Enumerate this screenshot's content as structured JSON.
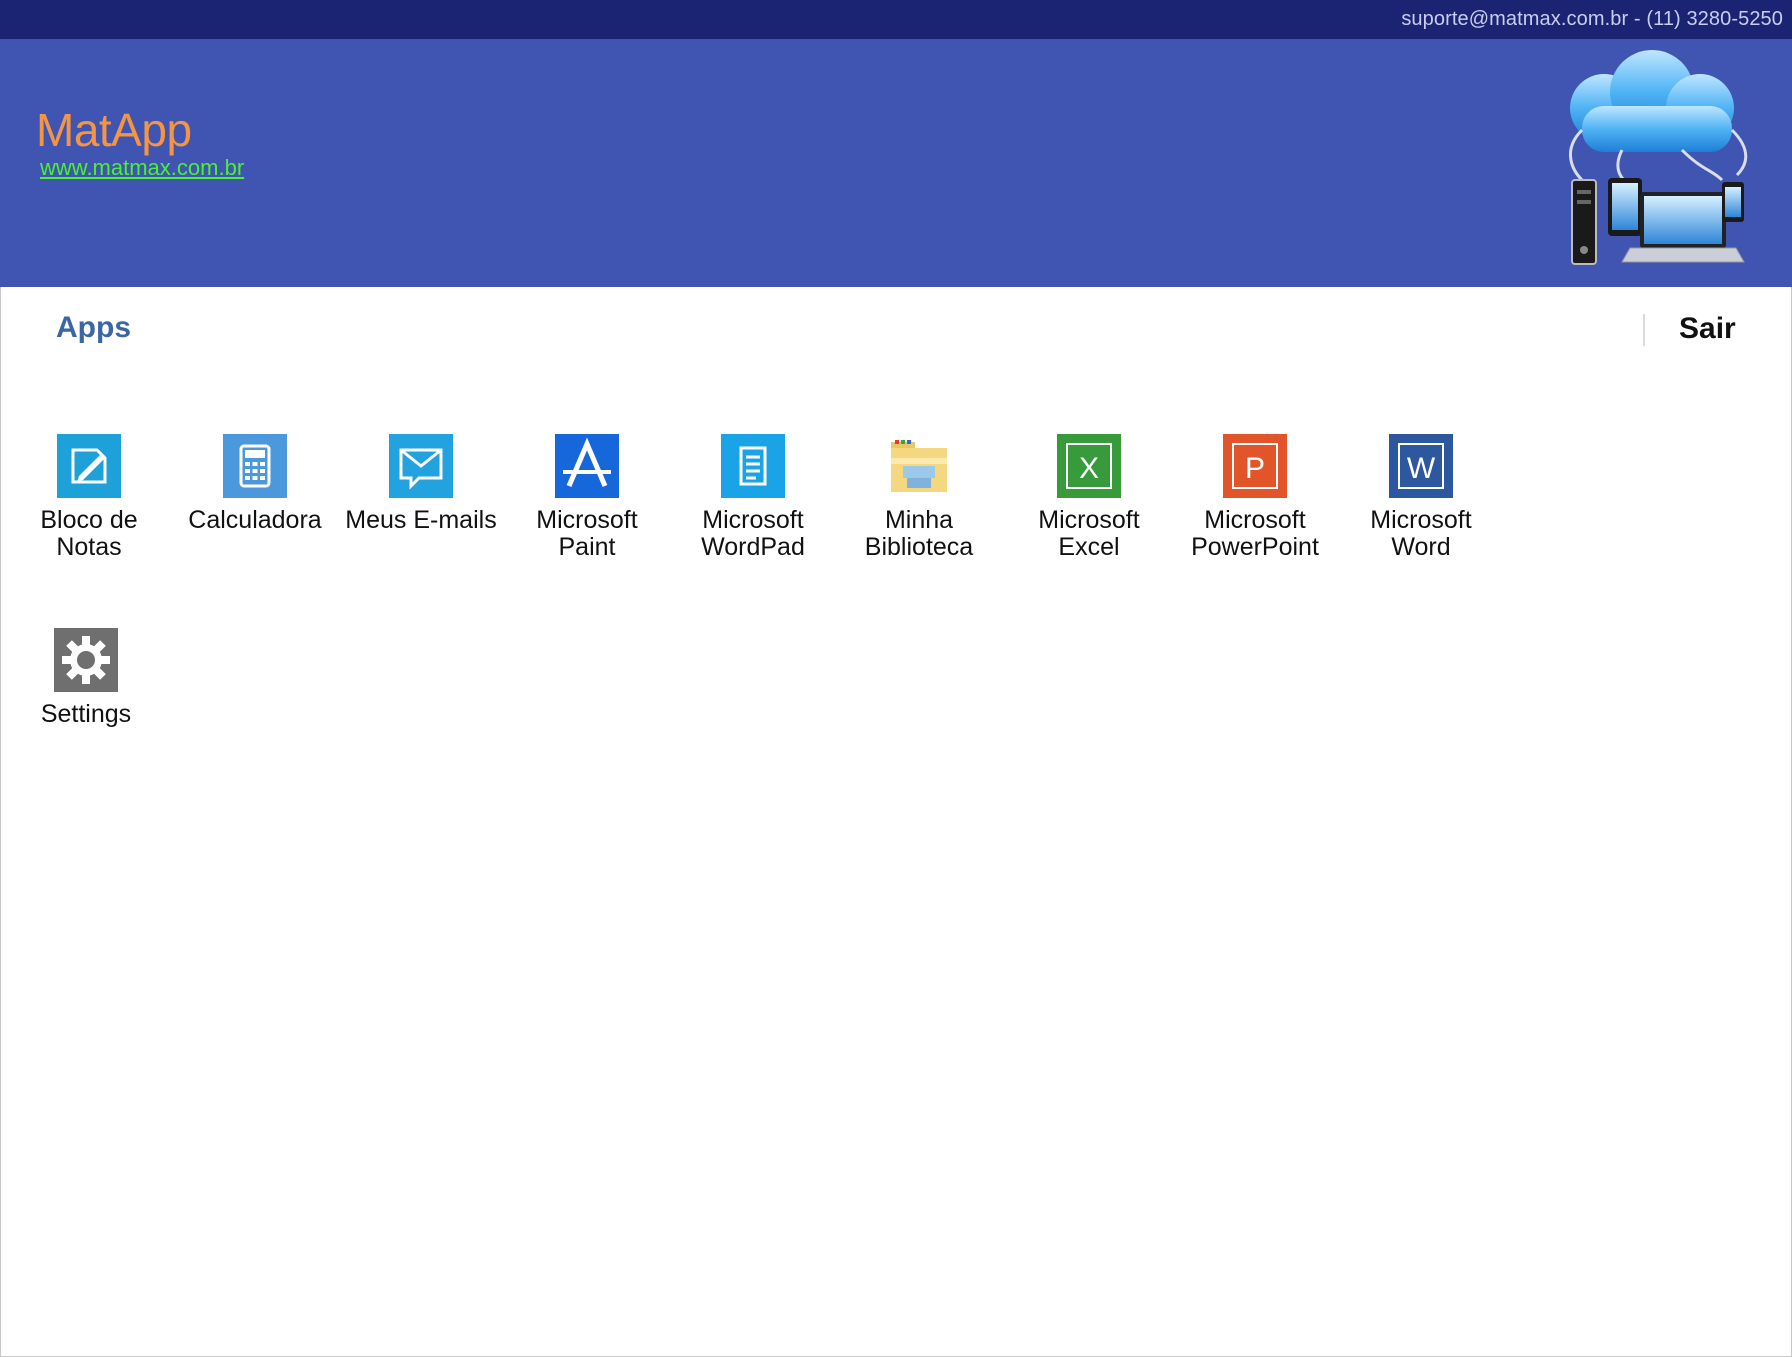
{
  "topbar": {
    "contact": "suporte@matmax.com.br - (11) 3280-5250"
  },
  "header": {
    "title": "MatApp",
    "link": "www.matmax.com.br"
  },
  "nav": {
    "section": "Apps",
    "logout": "Sair"
  },
  "apps": [
    {
      "line1": "Bloco de",
      "line2": "Notas",
      "icon": "notepad-icon",
      "color": "#1ea1d8"
    },
    {
      "line1": "Calculadora",
      "line2": "",
      "icon": "calculator-icon",
      "color": "#4c98dc"
    },
    {
      "line1": "Meus E-mails",
      "line2": "",
      "icon": "mail-icon",
      "color": "#22a2de"
    },
    {
      "line1": "Microsoft",
      "line2": "Paint",
      "icon": "paint-icon",
      "color": "#1667da"
    },
    {
      "line1": "Microsoft",
      "line2": "WordPad",
      "icon": "wordpad-icon",
      "color": "#1aa3e7"
    },
    {
      "line1": "Minha",
      "line2": "Biblioteca",
      "icon": "folder-icon",
      "color": "#f4d77f"
    },
    {
      "line1": "Microsoft",
      "line2": "Excel",
      "icon": "excel-icon",
      "color": "#379b3b"
    },
    {
      "line1": "Microsoft",
      "line2": "PowerPoint",
      "icon": "powerpoint-icon",
      "color": "#e2542a"
    },
    {
      "line1": "Microsoft",
      "line2": "Word",
      "icon": "word-icon",
      "color": "#2d579e"
    },
    {
      "line1": "Settings",
      "line2": "",
      "icon": "gear-icon",
      "color": "#6f6f6f"
    }
  ]
}
